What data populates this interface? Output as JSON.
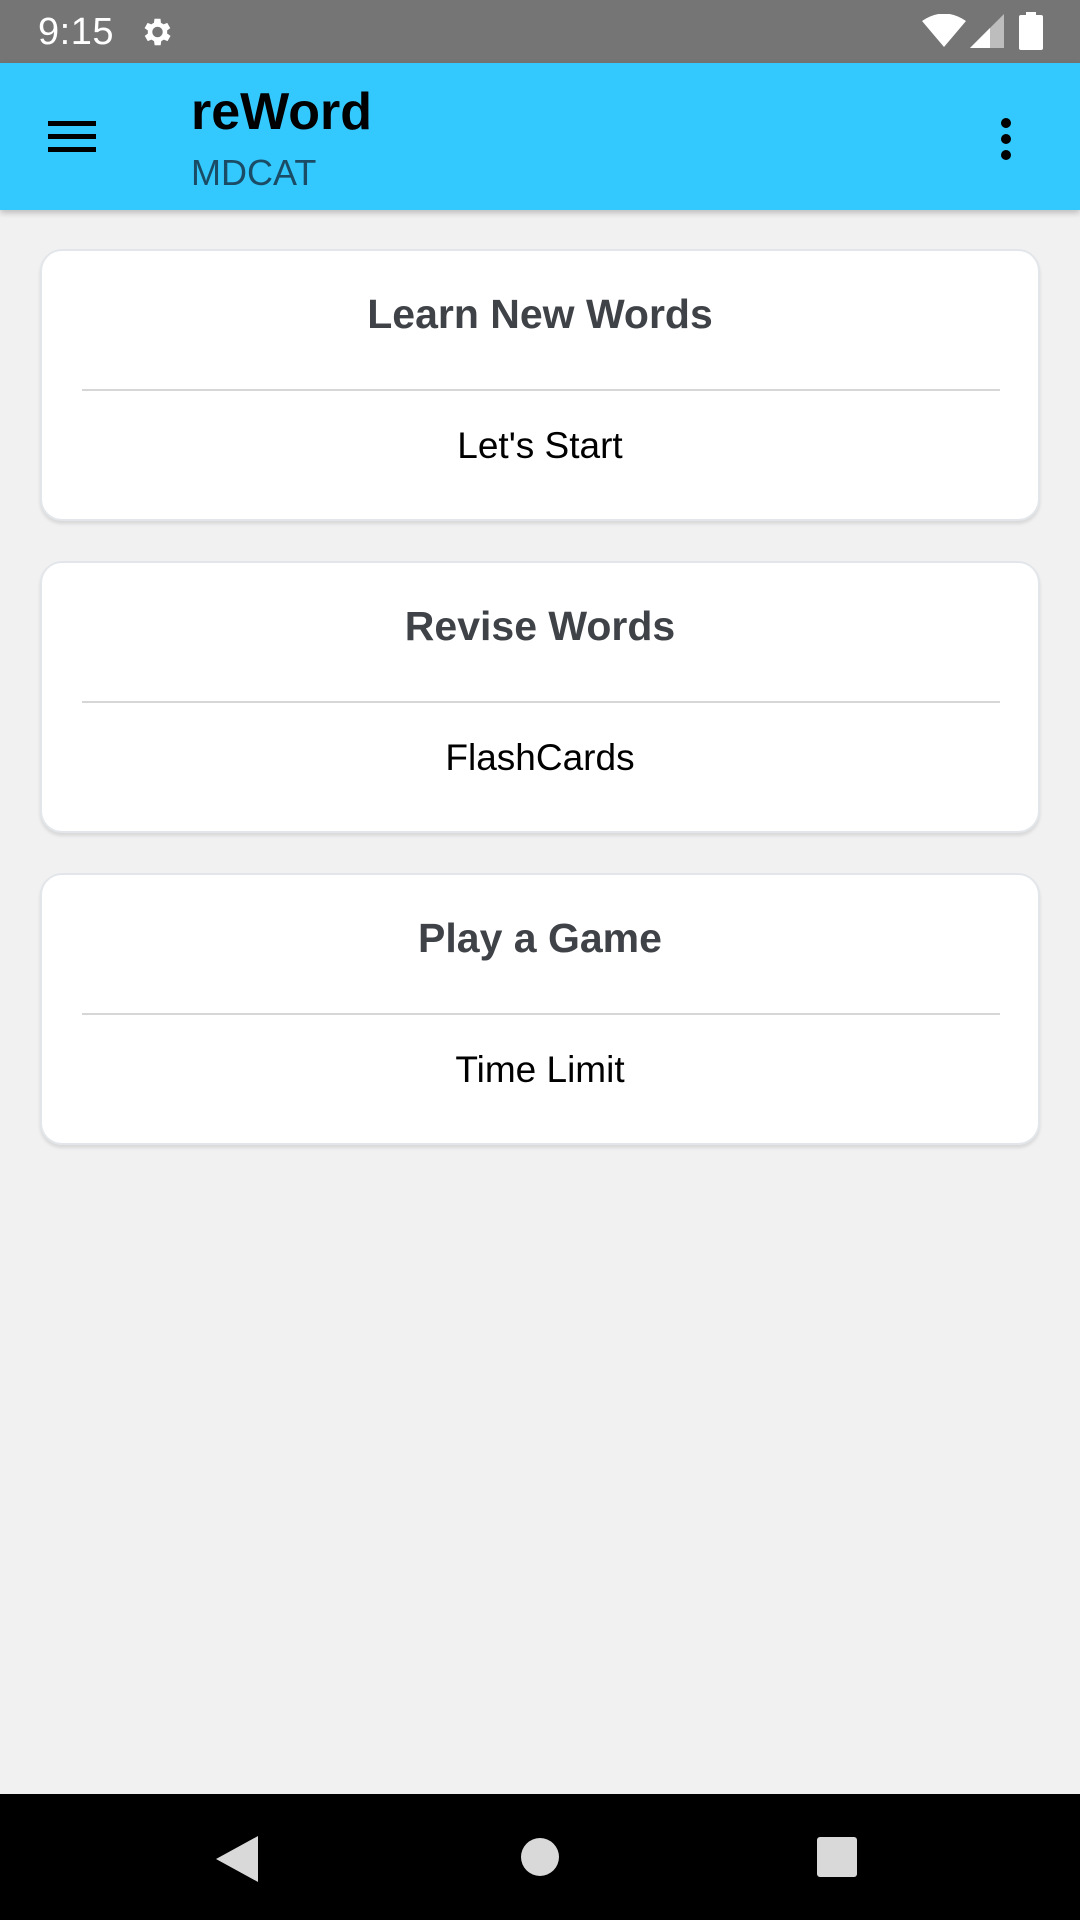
{
  "status_bar": {
    "time": "9:15",
    "icons": [
      "gear-icon",
      "wifi-icon",
      "cell-signal-icon",
      "battery-icon"
    ]
  },
  "app_bar": {
    "title": "reWord",
    "subtitle": "MDCAT",
    "background_color": "#33c9fe",
    "menu_icon": "hamburger-menu-icon",
    "overflow_icon": "more-vert-icon"
  },
  "cards": [
    {
      "title": "Learn New Words",
      "action": "Let's Start"
    },
    {
      "title": "Revise Words",
      "action": "FlashCards"
    },
    {
      "title": "Play a Game",
      "action": "Time Limit"
    }
  ],
  "nav_bar": {
    "icons": [
      "back-triangle-icon",
      "home-circle-icon",
      "recents-square-icon"
    ]
  }
}
